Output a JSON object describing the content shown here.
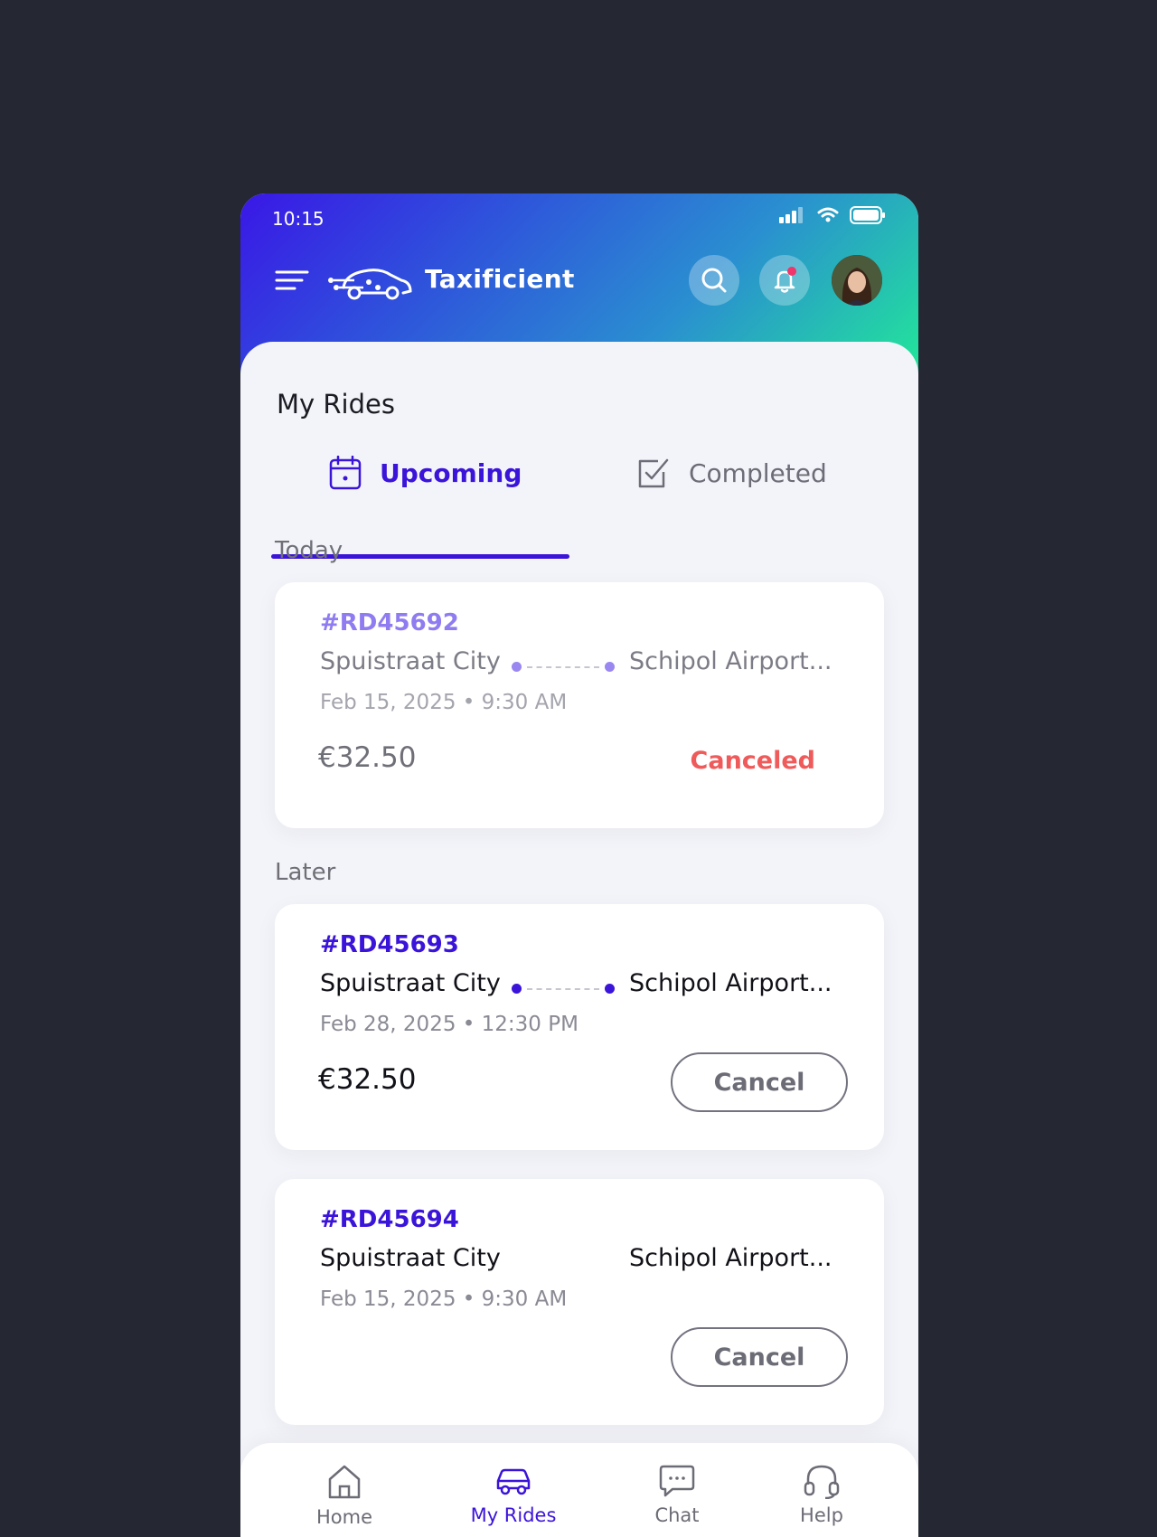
{
  "status_bar": {
    "time": "10:15"
  },
  "header": {
    "brand": "Taxificient",
    "colors": {
      "gradient_start": "#3a17e6",
      "gradient_end": "#22e69a"
    }
  },
  "page": {
    "title": "My Rides"
  },
  "tabs": [
    {
      "label": "Upcoming",
      "icon": "calendar-icon",
      "active": true
    },
    {
      "label": "Completed",
      "icon": "checkbox-icon",
      "active": false
    }
  ],
  "sections": {
    "today": "Today",
    "later": "Later"
  },
  "rides": [
    {
      "id": "#RD45692",
      "from": "Spuistraat City",
      "to": "Schipol Airport...",
      "date": "Feb 15, 2025 • 9:30 AM",
      "price": "€32.50",
      "status": "Canceled"
    },
    {
      "id": "#RD45693",
      "from": "Spuistraat City",
      "to": "Schipol Airport...",
      "date": "Feb 28, 2025 • 12:30 PM",
      "price": "€32.50",
      "action": "Cancel"
    },
    {
      "id": "#RD45694",
      "from": "Spuistraat City",
      "to": "Schipol Airport...",
      "date": "Feb 15, 2025 • 9:30 AM",
      "action": "Cancel"
    }
  ],
  "bottom_nav": [
    {
      "label": "Home",
      "icon": "home-icon"
    },
    {
      "label": "My Rides",
      "icon": "car-icon",
      "active": true
    },
    {
      "label": "Chat",
      "icon": "chat-icon"
    },
    {
      "label": "Help",
      "icon": "headset-icon"
    }
  ],
  "colors": {
    "accent": "#3b14d9",
    "danger": "#ef5a5a",
    "notification_dot": "#f0356b"
  }
}
